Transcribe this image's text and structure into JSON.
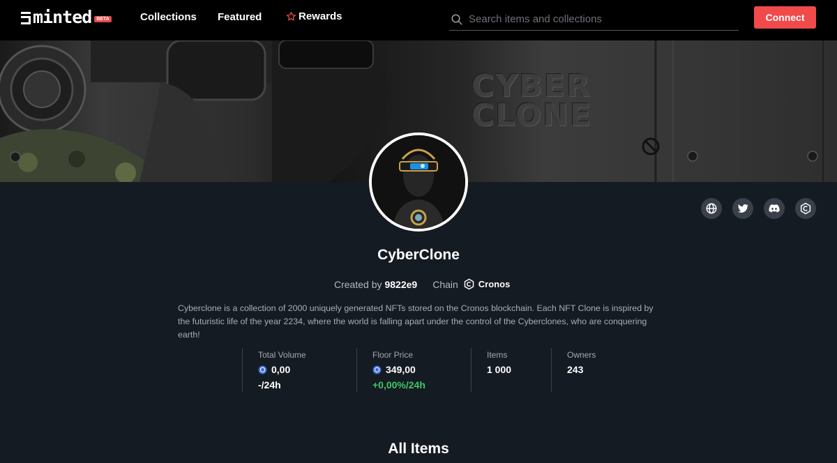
{
  "nav": {
    "logo_text": "minted",
    "beta_badge": "BETA",
    "collections": "Collections",
    "featured": "Featured",
    "rewards": "Rewards",
    "search_placeholder": "Search items and collections",
    "connect": "Connect",
    "accent_color": "#f04a4a"
  },
  "banner": {
    "word_1": "CYBER",
    "word_2": "CLONE"
  },
  "social": {
    "icons": [
      "globe-icon",
      "twitter-icon",
      "discord-icon",
      "cronos-icon"
    ]
  },
  "collection": {
    "name": "CyberClone",
    "created_by_label": "Created by",
    "creator": "9822e9",
    "chain_label": "Chain",
    "chain_name": "Cronos",
    "description": "Cyberclone is a collection of 2000 uniquely generated NFTs stored on the Cronos blockchain. Each NFT Clone is inspired by the futuristic life of the year 2234, where the world is falling apart under the control of the Cyberclones, who are conquering earth!"
  },
  "stats": {
    "total_volume": {
      "label": "Total Volume",
      "value": "0,00",
      "change": "-/24h"
    },
    "floor_price": {
      "label": "Floor Price",
      "value": "349,00",
      "change": "+0,00%/24h",
      "change_color": "#3bc865"
    },
    "items": {
      "label": "Items",
      "value": "1 000"
    },
    "owners": {
      "label": "Owners",
      "value": "243"
    }
  },
  "section": {
    "all_items": "All Items"
  }
}
